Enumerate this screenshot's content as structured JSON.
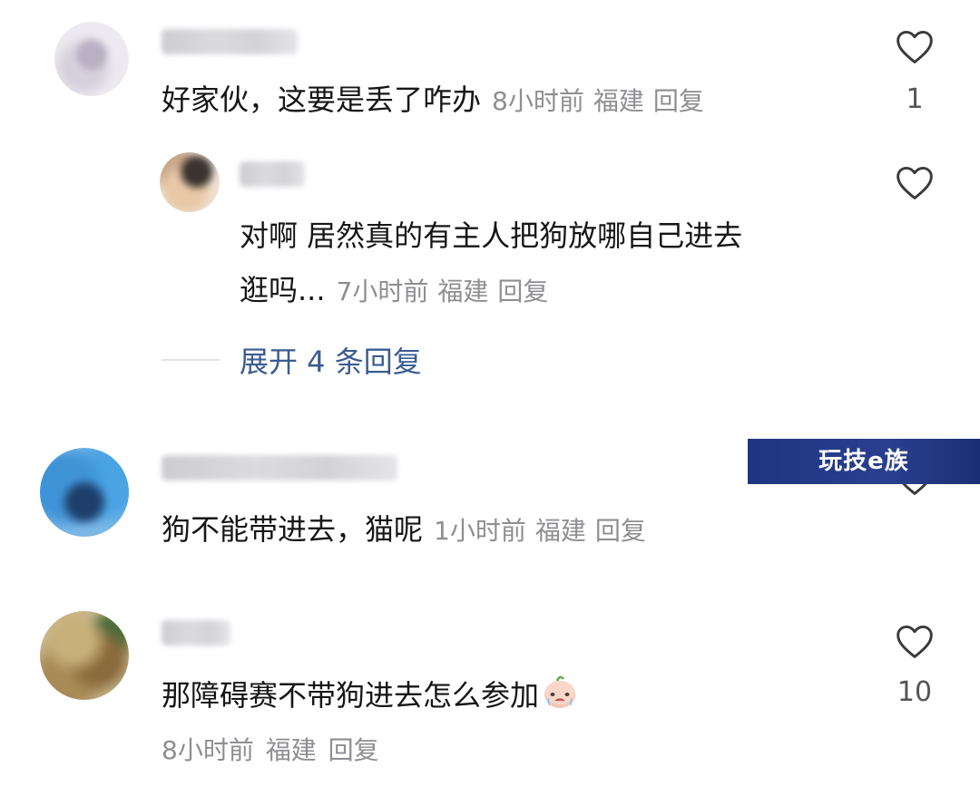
{
  "comments": [
    {
      "text": "好家伙，这要是丢了咋办",
      "time": "8小时前",
      "location": "福建",
      "reply_label": "回复",
      "likes": "1",
      "replies": [
        {
          "text_line1": "对啊 居然真的有主人把狗放哪自己进去",
          "text_line2": "逛吗...",
          "time": "7小时前",
          "location": "福建",
          "reply_label": "回复"
        }
      ],
      "expand_label": "展开 4 条回复"
    },
    {
      "text": "狗不能带进去，猫呢",
      "time": "1小时前",
      "location": "福建",
      "reply_label": "回复"
    },
    {
      "text": "那障碍赛不带狗进去怎么参加",
      "time": "8小时前",
      "location": "福建",
      "reply_label": "回复",
      "likes": "10",
      "emoji": "crying-face-emoji"
    }
  ],
  "watermark": "玩技e族",
  "icons": {
    "like": "heart-outline-icon"
  },
  "colors": {
    "meta_gray": "#8e8e93",
    "expand_blue": "#3a5b8f",
    "watermark_bg": "#1e3580"
  }
}
